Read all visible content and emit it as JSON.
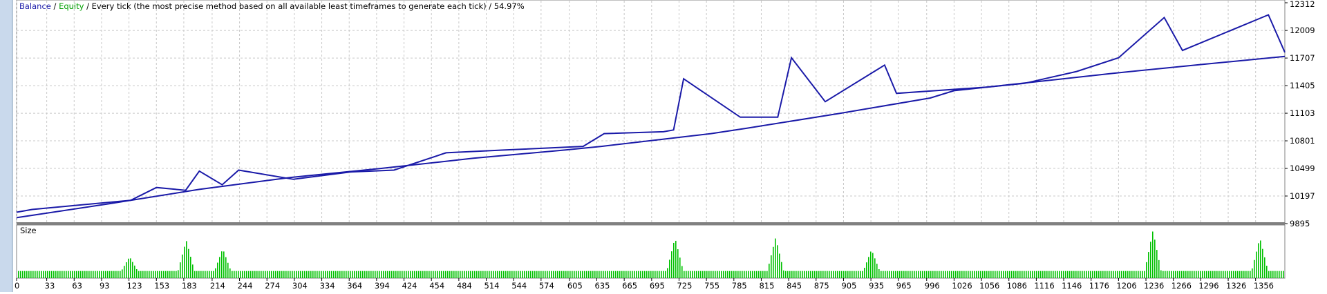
{
  "header": {
    "balance_label": "Balance",
    "separator": " / ",
    "equity_label": "Equity",
    "description": " / Every tick (the most precise method based on all available least timeframes to generate each tick) / 54.97%"
  },
  "size_label": "Size",
  "colors": {
    "balance": "#1a1aa8",
    "equity": "#00b000",
    "volume": "#00c000",
    "grid": "#c8c8c8",
    "left_strip": "#c9d9ec",
    "divider": "#808080"
  },
  "chart_data": [
    {
      "type": "line",
      "series": [
        {
          "name": "Balance",
          "x": [
            0,
            100,
            200,
            300,
            400,
            500,
            600,
            640,
            700,
            760,
            800,
            900,
            1000,
            1026,
            1100,
            1200,
            1300,
            1388
          ],
          "y": [
            9960,
            10110,
            10270,
            10400,
            10500,
            10610,
            10700,
            10740,
            10810,
            10880,
            10940,
            11100,
            11270,
            11350,
            11430,
            11540,
            11640,
            11725
          ]
        },
        {
          "name": "Equity",
          "x": [
            0,
            17,
            125,
            153,
            185,
            200,
            225,
            243,
            303,
            365,
            413,
            470,
            533,
            620,
            643,
            708,
            719,
            730,
            792,
            833,
            848,
            885,
            950,
            963,
            1063,
            1103,
            1160,
            1206,
            1256,
            1276,
            1370,
            1388
          ],
          "y": [
            10020,
            10050,
            10150,
            10290,
            10260,
            10470,
            10320,
            10480,
            10380,
            10460,
            10480,
            10670,
            10700,
            10740,
            10880,
            10900,
            10920,
            11480,
            11060,
            11060,
            11710,
            11230,
            11630,
            11320,
            11390,
            11430,
            11560,
            11710,
            12150,
            11790,
            12180,
            11770
          ]
        }
      ],
      "yticks": [
        12312,
        12009,
        11707,
        11405,
        11103,
        10801,
        10499,
        10197,
        9895
      ],
      "ylim": [
        9895,
        12312
      ],
      "xlim": [
        0,
        1388
      ],
      "grid": true
    },
    {
      "type": "bar",
      "title": "Size",
      "spikes": [
        {
          "x": 123,
          "v": 0.45
        },
        {
          "x": 185,
          "v": 0.8
        },
        {
          "x": 225,
          "v": 0.62
        },
        {
          "x": 720,
          "v": 0.85
        },
        {
          "x": 830,
          "v": 0.85
        },
        {
          "x": 935,
          "v": 0.6
        },
        {
          "x": 1243,
          "v": 1.0
        },
        {
          "x": 1360,
          "v": 0.85
        }
      ],
      "baseline": 0.15,
      "xticks": [
        0,
        33,
        63,
        93,
        123,
        153,
        183,
        214,
        244,
        274,
        304,
        334,
        364,
        394,
        424,
        454,
        484,
        514,
        544,
        574,
        605,
        635,
        665,
        695,
        725,
        755,
        785,
        815,
        845,
        875,
        905,
        935,
        965,
        996,
        1026,
        1056,
        1086,
        1116,
        1146,
        1176,
        1206,
        1236,
        1266,
        1296,
        1326,
        1356
      ],
      "xlim": [
        0,
        1388
      ]
    }
  ]
}
